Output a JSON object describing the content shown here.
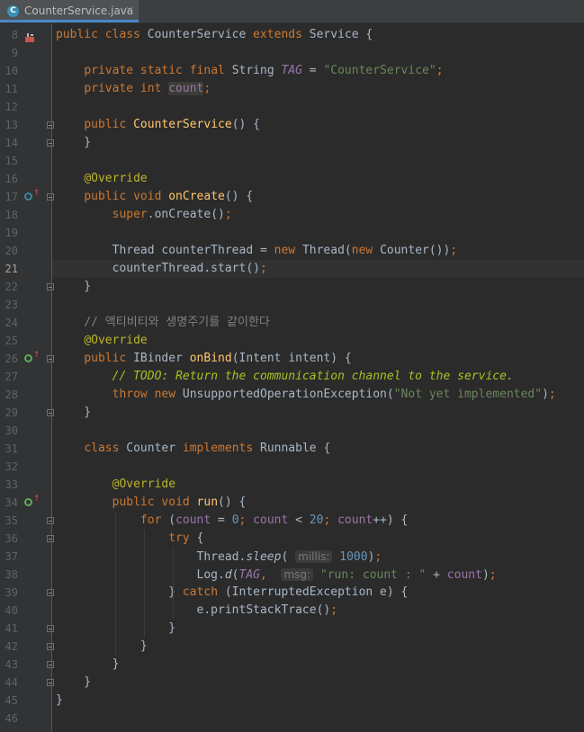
{
  "tab": {
    "icon_letter": "C",
    "filename": "CounterService.java",
    "close": "×"
  },
  "colors": {
    "keyword": "#cc7832",
    "method": "#ffc66d",
    "string": "#6a8759",
    "number": "#6897bb",
    "annotation": "#bbb529",
    "field": "#9876aa",
    "comment": "#808080",
    "todo": "#a8c023"
  },
  "current_line": "21",
  "lines": [
    {
      "n": "8",
      "tokens": [
        [
          "k",
          "public class "
        ],
        [
          "d",
          "CounterService "
        ],
        [
          "k",
          "extends "
        ],
        [
          "d",
          "Service {"
        ]
      ]
    },
    {
      "n": "9",
      "tokens": []
    },
    {
      "n": "10",
      "tokens": [
        [
          "d",
          "    "
        ],
        [
          "k",
          "private static final "
        ],
        [
          "d",
          "String "
        ],
        [
          "cst",
          "TAG"
        ],
        [
          "d",
          " = "
        ],
        [
          "s",
          "\"CounterService\""
        ],
        [
          "k",
          ";"
        ]
      ]
    },
    {
      "n": "11",
      "tokens": [
        [
          "d",
          "    "
        ],
        [
          "k",
          "private int "
        ],
        [
          "fldh",
          "count"
        ],
        [
          "k",
          ";"
        ]
      ]
    },
    {
      "n": "12",
      "tokens": []
    },
    {
      "n": "13",
      "tokens": [
        [
          "d",
          "    "
        ],
        [
          "k",
          "public "
        ],
        [
          "f",
          "CounterService"
        ],
        [
          "d",
          "() {"
        ]
      ]
    },
    {
      "n": "14",
      "tokens": [
        [
          "d",
          "    }"
        ]
      ]
    },
    {
      "n": "15",
      "tokens": []
    },
    {
      "n": "16",
      "tokens": [
        [
          "d",
          "    "
        ],
        [
          "a",
          "@Override"
        ]
      ]
    },
    {
      "n": "17",
      "tokens": [
        [
          "d",
          "    "
        ],
        [
          "k",
          "public void "
        ],
        [
          "f",
          "onCreate"
        ],
        [
          "d",
          "() {"
        ]
      ]
    },
    {
      "n": "18",
      "tokens": [
        [
          "d",
          "        "
        ],
        [
          "k",
          "super"
        ],
        [
          "d",
          ".onCreate()"
        ],
        [
          "k",
          ";"
        ]
      ]
    },
    {
      "n": "19",
      "tokens": []
    },
    {
      "n": "20",
      "tokens": [
        [
          "d",
          "        Thread counterThread = "
        ],
        [
          "k",
          "new "
        ],
        [
          "d",
          "Thread("
        ],
        [
          "k",
          "new "
        ],
        [
          "d",
          "Counter())"
        ],
        [
          "k",
          ";"
        ]
      ]
    },
    {
      "n": "21",
      "tokens": [
        [
          "d",
          "        counterThread.start()"
        ],
        [
          "k",
          ";"
        ]
      ]
    },
    {
      "n": "22",
      "tokens": [
        [
          "d",
          "    }"
        ]
      ]
    },
    {
      "n": "23",
      "tokens": []
    },
    {
      "n": "24",
      "tokens": [
        [
          "d",
          "    "
        ],
        [
          "cmt",
          "// 액티비티와 생명주기를 같이한다"
        ]
      ]
    },
    {
      "n": "25",
      "tokens": [
        [
          "d",
          "    "
        ],
        [
          "a",
          "@Override"
        ]
      ]
    },
    {
      "n": "26",
      "tokens": [
        [
          "d",
          "    "
        ],
        [
          "k",
          "public "
        ],
        [
          "d",
          "IBinder "
        ],
        [
          "f",
          "onBind"
        ],
        [
          "d",
          "(Intent intent) {"
        ]
      ]
    },
    {
      "n": "27",
      "tokens": [
        [
          "d",
          "        "
        ],
        [
          "todo",
          "// TODO: Return the communication channel to the service."
        ]
      ]
    },
    {
      "n": "28",
      "tokens": [
        [
          "d",
          "        "
        ],
        [
          "k",
          "throw new "
        ],
        [
          "d",
          "UnsupportedOperationException("
        ],
        [
          "s",
          "\"Not yet implemented\""
        ],
        [
          "d",
          ")"
        ],
        [
          "k",
          ";"
        ]
      ]
    },
    {
      "n": "29",
      "tokens": [
        [
          "d",
          "    }"
        ]
      ]
    },
    {
      "n": "30",
      "tokens": []
    },
    {
      "n": "31",
      "tokens": [
        [
          "d",
          "    "
        ],
        [
          "k",
          "class "
        ],
        [
          "d",
          "Counter "
        ],
        [
          "k",
          "implements "
        ],
        [
          "d",
          "Runnable {"
        ]
      ]
    },
    {
      "n": "32",
      "tokens": []
    },
    {
      "n": "33",
      "tokens": [
        [
          "d",
          "        "
        ],
        [
          "a",
          "@Override"
        ]
      ]
    },
    {
      "n": "34",
      "tokens": [
        [
          "d",
          "        "
        ],
        [
          "k",
          "public void "
        ],
        [
          "f",
          "run"
        ],
        [
          "d",
          "() {"
        ]
      ]
    },
    {
      "n": "35",
      "tokens": [
        [
          "d",
          "            "
        ],
        [
          "k",
          "for "
        ],
        [
          "d",
          "("
        ],
        [
          "fld",
          "count"
        ],
        [
          "d",
          " = "
        ],
        [
          "n",
          "0"
        ],
        [
          "k",
          "; "
        ],
        [
          "fld",
          "count"
        ],
        [
          "d",
          " < "
        ],
        [
          "n",
          "20"
        ],
        [
          "k",
          "; "
        ],
        [
          "fld",
          "count"
        ],
        [
          "d",
          "++) {"
        ]
      ]
    },
    {
      "n": "36",
      "tokens": [
        [
          "d",
          "                "
        ],
        [
          "k",
          "try "
        ],
        [
          "d",
          "{"
        ]
      ]
    },
    {
      "n": "37",
      "tokens": [
        [
          "d",
          "                    Thread."
        ],
        [
          "it",
          "sleep"
        ],
        [
          "d",
          "( "
        ],
        [
          "hint",
          "millis:"
        ],
        [
          "d",
          " "
        ],
        [
          "n",
          "1000"
        ],
        [
          "d",
          ")"
        ],
        [
          "k",
          ";"
        ]
      ]
    },
    {
      "n": "38",
      "tokens": [
        [
          "d",
          "                    Log."
        ],
        [
          "it",
          "d"
        ],
        [
          "d",
          "("
        ],
        [
          "cst",
          "TAG"
        ],
        [
          "k",
          ", "
        ],
        [
          "d",
          " "
        ],
        [
          "hint",
          "msg:"
        ],
        [
          "d",
          " "
        ],
        [
          "s",
          "\"run: count : \""
        ],
        [
          "d",
          " + "
        ],
        [
          "fld",
          "count"
        ],
        [
          "d",
          ")"
        ],
        [
          "k",
          ";"
        ]
      ]
    },
    {
      "n": "39",
      "tokens": [
        [
          "d",
          "                } "
        ],
        [
          "k",
          "catch "
        ],
        [
          "d",
          "(InterruptedException e) {"
        ]
      ]
    },
    {
      "n": "40",
      "tokens": [
        [
          "d",
          "                    e.printStackTrace()"
        ],
        [
          "k",
          ";"
        ]
      ]
    },
    {
      "n": "41",
      "tokens": [
        [
          "d",
          "                }"
        ]
      ]
    },
    {
      "n": "42",
      "tokens": [
        [
          "d",
          "            }"
        ]
      ]
    },
    {
      "n": "43",
      "tokens": [
        [
          "d",
          "        }"
        ]
      ]
    },
    {
      "n": "44",
      "tokens": [
        [
          "d",
          "    }"
        ]
      ]
    },
    {
      "n": "45",
      "tokens": [
        [
          "d",
          "}"
        ]
      ]
    },
    {
      "n": "46",
      "tokens": []
    }
  ]
}
